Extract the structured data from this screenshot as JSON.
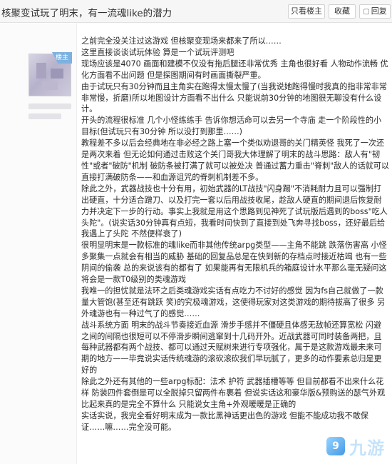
{
  "header": {
    "title": "核聚变试玩了明末，有一流魂like的潜力",
    "buttons": {
      "only_op": "只看楼主",
      "favorite": "收藏",
      "reply_icon": "speech-bubble-icon",
      "reply": "回复"
    }
  },
  "post": {
    "badge": "楼主",
    "paragraphs": [
      "之前完全没关注过这游戏 但核聚变现场来都来了所以……",
      "这里直接谈谈试玩体验 算是一个试玩评测吧",
      "现场应该是4070 画面和建模不仅没有拖后腿还非常优秀 主角也很好看 人物动作流畅 优化方面看不出问题 但是探图期间有时画面撕裂严重。",
      "由于试玩只有30分钟而且主角实在跑得太慢太慢了(当我说她跑得慢时我真的指非常非常非常慢，折磨)所以地图设计方面看不出什么 只能说前30分钟的地图很无聊没有什么设计。",
      "开头的流程很标准 几个小怪练练手 告诉你想活命可以去另一个寺庙 走一个阶段性的小目标(但试玩只有30分钟 所以没打到那里……)",
      "教程差不多以后会经典地在非必经之路上塞一个类似劝退哥的关门精英怪 我死了一次还是两次来着 但无论如何通过击败这个关门哥我大体理解了明末的战斗思路：敌人有\"韧性\"或者\"破防\"机制 破防条被打满了就可以被处决 普通过蓄力重击\"脊刺\"敌人的话就可以直接打满破防条——和血源诅咒的脊刺机制差不多。",
      "除此之外，武器战技也十分有用，初始武器的LT战技\"闪身踢\"不消耗耐力且可以强制打出硬直，十分适合蹭刀、以及打完一套以后用战技收尾，趁敌人硬直的期间退后恢复耐力并决定下一步的行动。事实上我就是用这个思路到见神死了试玩版后遇到的boss\"吃人头陀\"。(说实话30分钟真有点短，我看时间快到了直接到处飞奔寻找boss，还好最后给我遇上了头陀 不然便样衰了)",
      "很明显明末是一款标准的魂like而非其他传统arpg类型——主角不能跳 跌落伤害高 小怪多聚集一点就会有相当的威胁 基础的回复品总是在快到新的存档点时接近枯竭 也有一些阴间的偷袭 总的来说该有的都有了 如果能再有无限机兵的箱庭设计水平那么毫无疑问这将会是一款T0级别的类魂游戏",
      "我唯一的担忧就是法环之后类魂游戏实话有点吃力不讨好的感觉 因为fs自己就做了一款量大管饱(甚至还有跳跃 笑)的究极魂游戏，这使得玩家对这类游戏的期待拔高了很多 另外魂游也有一种过气了的感觉……",
      "战斗系统方面 明末的战斗节奏接近血源 滑步手感并不僵硬且体感无敌帧还算宽松 闪避之间的间隔也很短可以不停滑步瞬间逃窜到十几码开外。近战武器可同时装备两把，且每种武器都有两个战技、都可以通过天赋树来进行专项强化，属于是这款游戏最未来可期的地方——毕竟说实话传统魂游的滚砍滚砍我们早玩腻了，更多的动作要素总归是更好的",
      "除此之外还有其他的一些arpg标配：法术 护符 武器插槽等等 但目前都看不出来什么花样 防装四件套倒是可以全脱掉只留两件布裹着 但说实话这和豪华版&预购送的瑟气外观比起来真的是完全不算什么 只能说女主角+外观暖暖是正确的",
      "实话实说，我完全看好明末成为一款比黑神话更出色的游戏 但能不能成功我不敢保证……嘛……完全没可能。"
    ]
  },
  "watermark": {
    "icon": "jiuyou-logo-icon",
    "logo_text": "九游"
  },
  "colors": {
    "titlebar_bg": "#f6f6f6",
    "badge_bg": "#7db1df",
    "watermark": "#bfe1fb"
  }
}
